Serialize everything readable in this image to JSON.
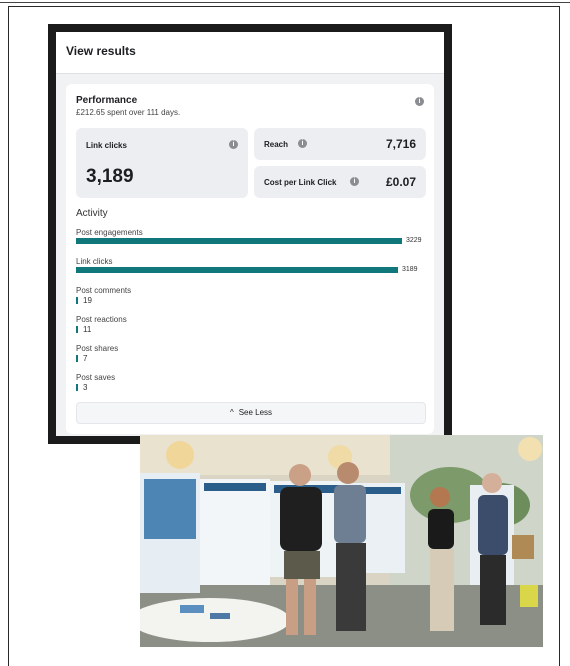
{
  "header": {
    "title": "View results"
  },
  "performance": {
    "title": "Performance",
    "subtitle": "£212.65 spent over 111 days.",
    "info_icon": "info-icon"
  },
  "metrics": {
    "link_clicks": {
      "label": "Link clicks",
      "value": "3,189"
    },
    "reach": {
      "label": "Reach",
      "value": "7,716"
    },
    "cost_per_link_click": {
      "label": "Cost per Link Click",
      "value": "£0.07"
    }
  },
  "activity": {
    "title": "Activity",
    "max": 3229,
    "items": [
      {
        "label": "Post engagements",
        "value": 3229,
        "value_text": "3229"
      },
      {
        "label": "Link clicks",
        "value": 3189,
        "value_text": "3189"
      },
      {
        "label": "Post comments",
        "value": 19,
        "value_text": "19"
      },
      {
        "label": "Post reactions",
        "value": 11,
        "value_text": "11"
      },
      {
        "label": "Post shares",
        "value": 7,
        "value_text": "7"
      },
      {
        "label": "Post saves",
        "value": 3,
        "value_text": "3"
      }
    ]
  },
  "see_less": {
    "label": "See Less",
    "icon": "chevron-up-icon"
  },
  "colors": {
    "accent": "#10787a",
    "card_bg": "#ffffff",
    "metric_bg": "#eceef1",
    "panel_frame": "#1b1b1b"
  }
}
